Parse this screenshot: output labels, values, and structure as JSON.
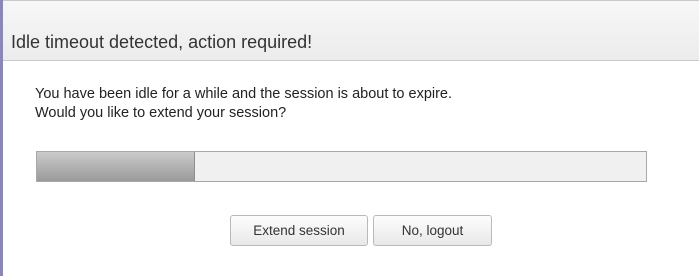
{
  "dialog": {
    "title": "Idle timeout detected, action required!",
    "message_line1": "You have been idle for a while and the session is about to expire.",
    "message_line2": "Would you like to extend your session?",
    "progress_percent": 26,
    "extend_label": "Extend session",
    "logout_label": "No, logout"
  },
  "colors": {
    "accent_border": "#8a86c4",
    "titlebar_bg": "#ececec",
    "progress_fill": "#aaaaaa"
  }
}
